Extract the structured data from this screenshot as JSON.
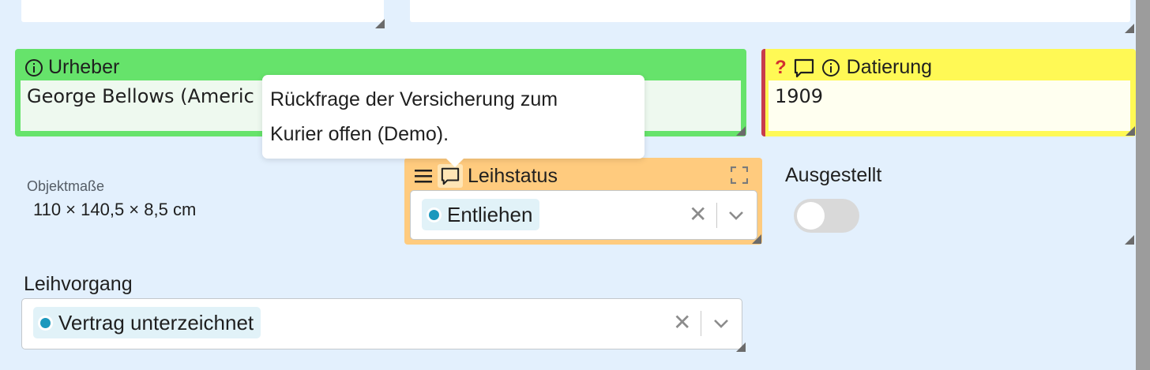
{
  "fields": {
    "urheber": {
      "label": "Urheber",
      "value": "George Bellows (Americ"
    },
    "datierung": {
      "label": "Datierung",
      "value": "1909",
      "flag": "?"
    },
    "objektmasse": {
      "label": "Objektmaße",
      "value": "110 × 140,5 × 8,5 cm"
    },
    "leihstatus": {
      "label": "Leihstatus",
      "value": "Entliehen"
    },
    "ausgestellt": {
      "label": "Ausgestellt",
      "checked": false
    },
    "leihvorgang": {
      "label": "Leihvorgang",
      "value": "Vertrag unterzeichnet"
    }
  },
  "tooltip": {
    "line1": "Rückfrage der Versicherung zum",
    "line2": "Kurier offen (Demo)."
  },
  "colors": {
    "urheber_bg": "#66e36b",
    "datierung_bg": "#fff955",
    "datierung_accent": "#c83c4b",
    "leihstatus_bg": "#ffcb7e",
    "chip_dot": "#1b98bd",
    "page_bg": "#e3f0fd"
  },
  "icons": {
    "info": "info-icon",
    "comment": "comment-icon",
    "menu": "menu-icon",
    "expand": "expand-icon",
    "clear": "clear-icon",
    "chevron": "chevron-down-icon"
  }
}
